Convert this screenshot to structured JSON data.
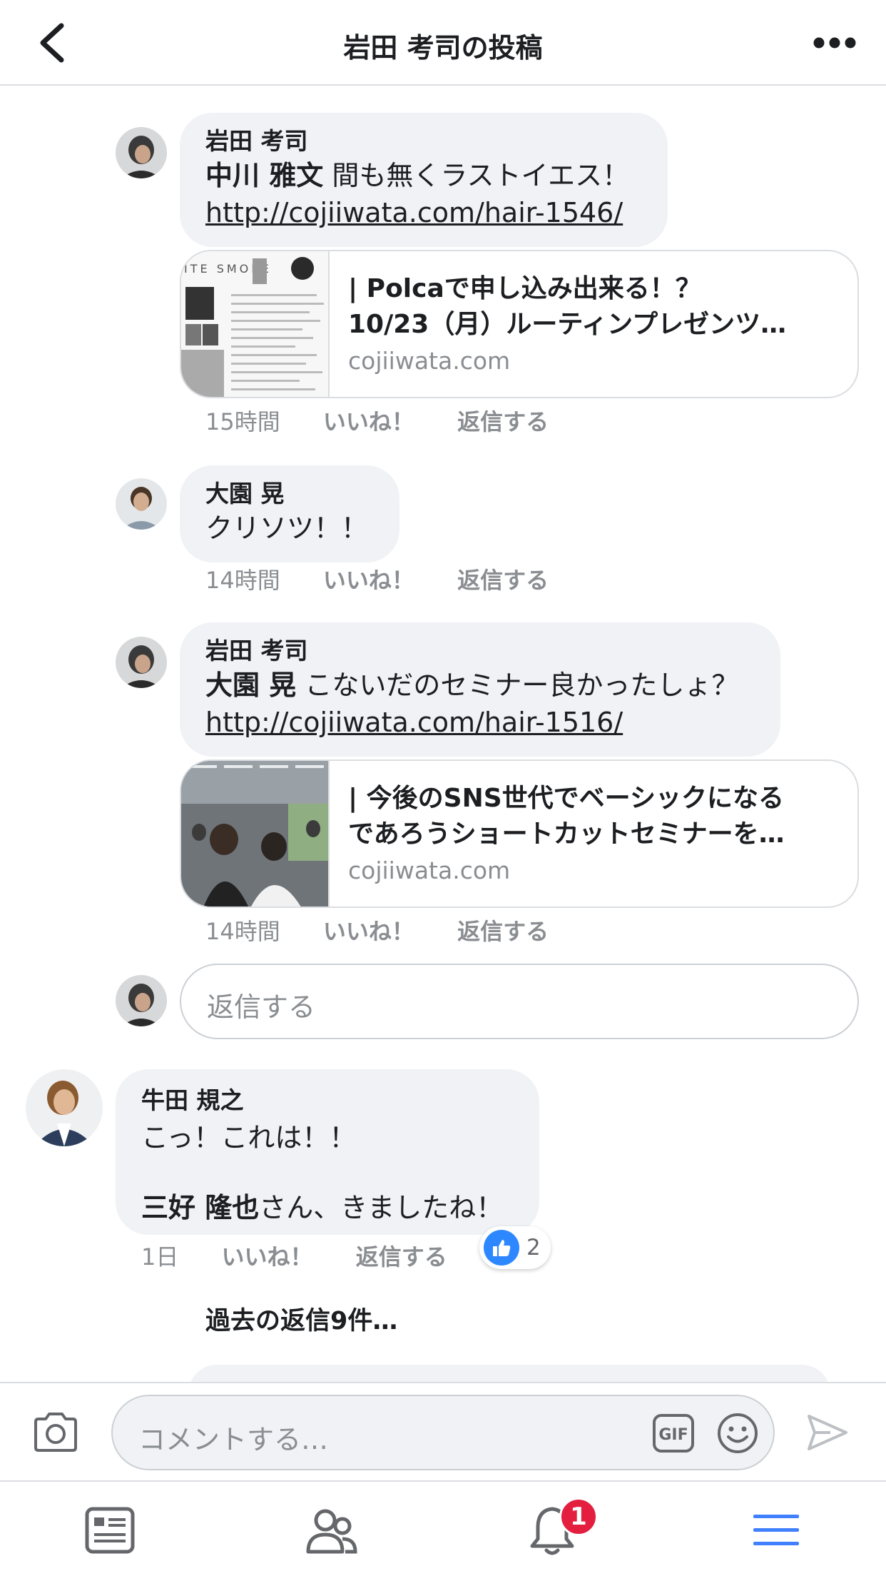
{
  "header": {
    "title": "岩田 考司の投稿"
  },
  "thread": {
    "replies": [
      {
        "author": "岩田 考司",
        "mention": "中川 雅文",
        "text": " 間も無くラストイエス！",
        "link": "http://cojiiwata.com/hair-1546/",
        "card": {
          "title_line1": "| Polcaで申し込み出来る！？",
          "title_line2": "10/23（月）ルーティンプレゼンツ…",
          "domain": "cojiiwata.com",
          "thumb_text": "ITE SMOKE"
        },
        "time": "15時間",
        "like": "いいね！",
        "reply": "返信する"
      },
      {
        "author": "大園 晃",
        "text": "クリソツ！！",
        "time": "14時間",
        "like": "いいね！",
        "reply": "返信する"
      },
      {
        "author": "岩田 考司",
        "mention": "大園 晃",
        "text": " こないだのセミナー良かったしょ？",
        "link": "http://cojiiwata.com/hair-1516/",
        "card": {
          "title_line1": "| 今後のSNS世代でベーシックになる",
          "title_line2": "であろうショートカットセミナーを…",
          "domain": "cojiiwata.com"
        },
        "time": "14時間",
        "like": "いいね！",
        "reply": "返信する"
      }
    ],
    "reply_box_placeholder": "返信する",
    "comment": {
      "author": "牛田 規之",
      "line1": "こっ！これは！！",
      "mention": "三好 隆也",
      "line2": "さん、きましたね！",
      "time": "1日",
      "like": "いいね！",
      "reply": "返信する",
      "reaction_count": "2"
    },
    "previous_replies": "過去の返信9件…"
  },
  "composer": {
    "placeholder": "コメントする…",
    "gif_label": "GIF"
  },
  "tabbar": {
    "notification_badge": "1"
  },
  "colors": {
    "accent": "#2d88ff",
    "badge": "#e41e3f",
    "bubble": "#f0f2f5",
    "meta": "#8a8d91"
  }
}
